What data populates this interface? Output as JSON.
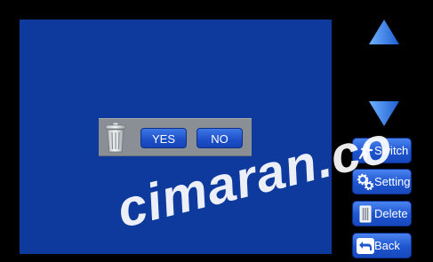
{
  "dialog": {
    "yes_label": "YES",
    "no_label": "NO",
    "icon": "trash-icon"
  },
  "nav": {
    "up_icon": "arrow-up-icon",
    "down_icon": "arrow-down-icon"
  },
  "side_buttons": [
    {
      "label": "Switch",
      "icon": "running-person-icon"
    },
    {
      "label": "Setting",
      "icon": "gears-icon"
    },
    {
      "label": "Delete",
      "icon": "trash-icon"
    },
    {
      "label": "Back",
      "icon": "back-arrow-icon"
    }
  ],
  "watermark": "cimaran.co",
  "colors": {
    "screen": "#0d3a9c",
    "button": "#1e55cf",
    "arrow": "#2f7be6",
    "background": "#000000"
  }
}
